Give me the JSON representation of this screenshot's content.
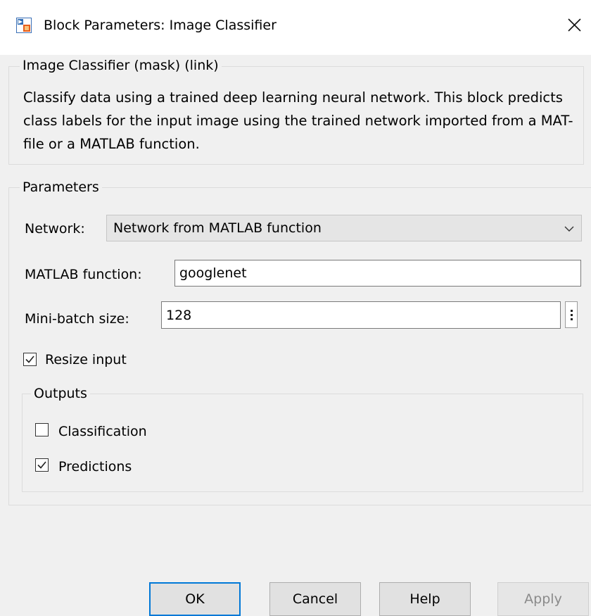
{
  "window": {
    "title": "Block Parameters: Image Classifier",
    "icon": "simulink-block-icon"
  },
  "mask_group": {
    "legend": "Image Classifier (mask) (link)",
    "description": "Classify data using a trained deep learning neural network. This block predicts class labels for the input image using the trained network imported from a MAT-file or a MATLAB function."
  },
  "parameters": {
    "legend": "Parameters",
    "network_label": "Network:",
    "network_value": "Network from MATLAB function",
    "matlab_function_label": "MATLAB function:",
    "matlab_function_value": "googlenet",
    "mini_batch_label": "Mini-batch size:",
    "mini_batch_value": "128",
    "resize_input_label": "Resize input",
    "resize_input_checked": true
  },
  "outputs": {
    "legend": "Outputs",
    "classification_label": "Classification",
    "classification_checked": false,
    "predictions_label": "Predictions",
    "predictions_checked": true
  },
  "buttons": {
    "ok": "OK",
    "cancel": "Cancel",
    "help": "Help",
    "apply": "Apply"
  },
  "colors": {
    "default_button_border": "#0078d7",
    "background": "#f0f0f0"
  }
}
